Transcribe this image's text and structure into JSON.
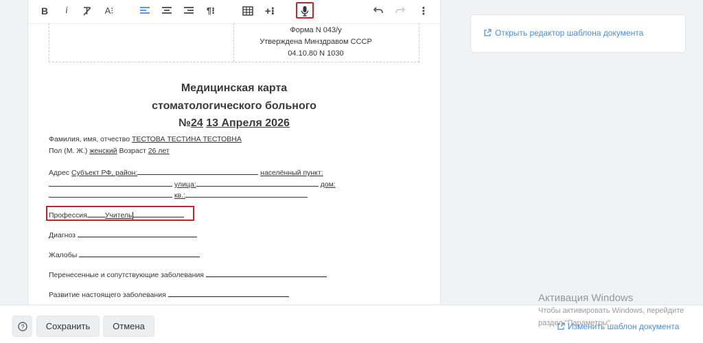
{
  "toolbar": {
    "buttons": [
      {
        "name": "bold-button",
        "glyph": "B"
      },
      {
        "name": "italic-button",
        "glyph": "i"
      },
      {
        "name": "clear-format-button",
        "glyph": "T̸"
      },
      {
        "name": "font-size-button",
        "glyph": "A⁝"
      },
      {
        "name": "align-left-button",
        "glyph": ""
      },
      {
        "name": "align-center-button",
        "glyph": ""
      },
      {
        "name": "align-right-button",
        "glyph": ""
      },
      {
        "name": "paragraph-button",
        "glyph": "¶⁝"
      },
      {
        "name": "table-button",
        "glyph": ""
      },
      {
        "name": "insert-button",
        "glyph": "+⁝"
      },
      {
        "name": "microphone-button",
        "glyph": ""
      },
      {
        "name": "undo-button",
        "glyph": ""
      },
      {
        "name": "redo-button",
        "glyph": ""
      },
      {
        "name": "more-button",
        "glyph": "⋮"
      }
    ]
  },
  "document": {
    "header": {
      "form": "Форма N 043/у",
      "approved": "Утверждена Минздравом СССР",
      "date": "04.10.80 N 1030"
    },
    "title_line1": "Медицинская карта",
    "title_line2": "стоматологического больного",
    "title_number_prefix": "№",
    "title_number": "24",
    "title_date": "13 Апреля 2026",
    "fio_label": "Фамилия, имя, отчество",
    "fio_value": "ТЕСТОВА ТЕСТИНА ТЕСТОВНА",
    "sex_label": "Пол (М. Ж.)",
    "sex_value": "женский",
    "age_label": "Возраст",
    "age_value": "26 лет",
    "address_label": "Адрес",
    "region_label": "Субъект РФ, район:",
    "settlement_label": "населённый пункт:",
    "street_label": "улица:",
    "house_label": "дом:",
    "apt_label": "кв.:",
    "profession_label": "Профессия",
    "profession_value": "Учитель",
    "diagnosis_label": "Диагноз",
    "complaints_label": "Жалобы",
    "diseases_label": "Перенесенные и сопутствующие заболевания",
    "development_label": "Развитие настоящего заболевания"
  },
  "right_panel": {
    "open_template_editor": "Открыть редактор шаблона документа"
  },
  "footer": {
    "help": "?",
    "save": "Сохранить",
    "cancel": "Отмена",
    "change_template": "Изменить шаблон документа"
  },
  "watermark": {
    "title": "Активация Windows",
    "line1": "Чтобы активировать Windows, перейдите",
    "line2": "раздел \"Параметры\"."
  },
  "colors": {
    "highlight": "#c0262c",
    "link": "#4a8fd6",
    "align_active": "#3b8de0"
  }
}
